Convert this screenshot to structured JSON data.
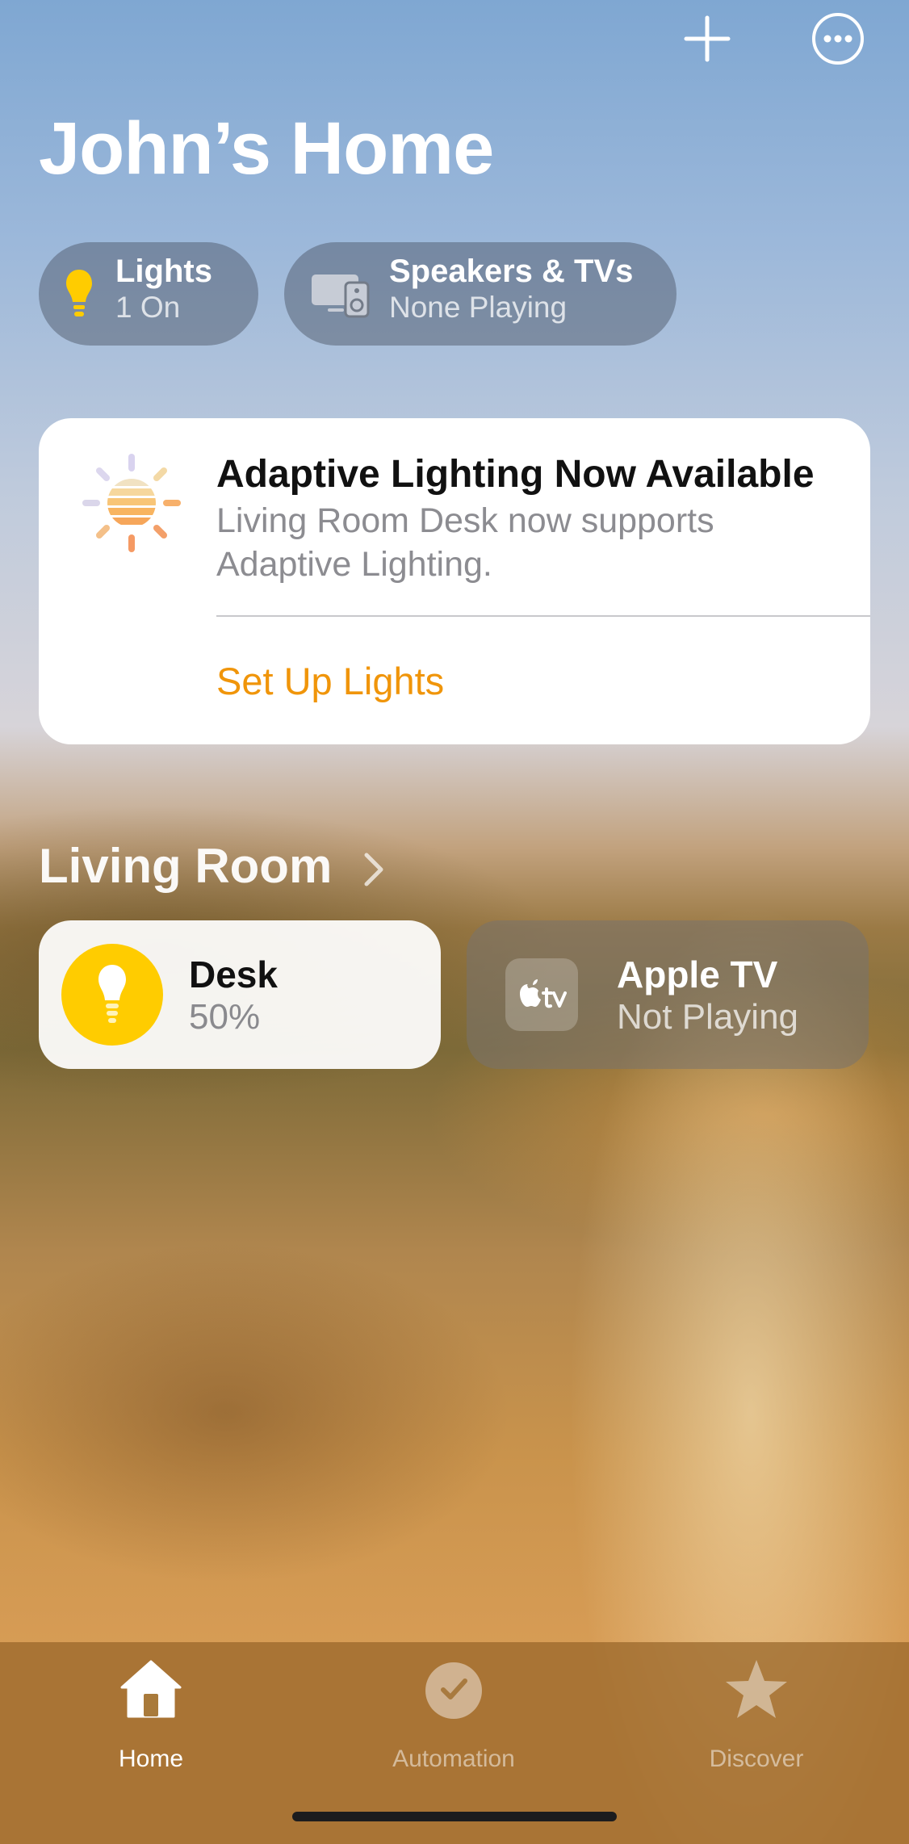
{
  "header": {
    "title": "John’s Home",
    "add_icon": "plus-icon",
    "more_icon": "ellipsis-circle-icon"
  },
  "status_pills": [
    {
      "title": "Lights",
      "subtitle": "1 On",
      "icon": "lightbulb-icon"
    },
    {
      "title": "Speakers & TVs",
      "subtitle": "None Playing",
      "icon": "speaker-tv-icon"
    }
  ],
  "banner": {
    "icon": "adaptive-lighting-sun-icon",
    "title": "Adaptive Lighting Now Available",
    "description": "Living Room Desk now supports Adaptive Lighting.",
    "action_label": "Set Up Lights",
    "action_color": "#f0950a"
  },
  "room": {
    "name": "Living Room",
    "accessories": [
      {
        "name": "Desk",
        "status": "50%",
        "icon": "lightbulb-icon",
        "on": true,
        "accent": "#ffcc00"
      },
      {
        "name": "Apple TV",
        "status": "Not Playing",
        "icon": "apple-tv-icon",
        "on": false
      }
    ]
  },
  "tab_bar": {
    "tabs": [
      {
        "label": "Home",
        "icon": "house-icon",
        "selected": true
      },
      {
        "label": "Automation",
        "icon": "clock-check-icon",
        "selected": false
      },
      {
        "label": "Discover",
        "icon": "star-icon",
        "selected": false
      }
    ]
  }
}
